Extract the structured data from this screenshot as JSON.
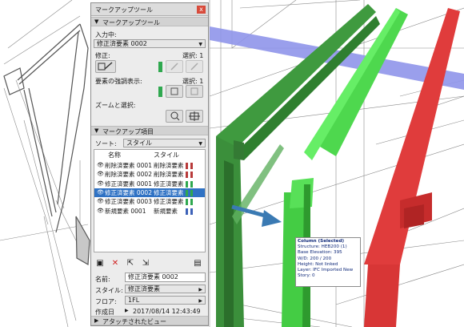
{
  "palette": {
    "title": "マークアップツール",
    "close_glyph": "x",
    "tools_section": "マークアップツール",
    "input_label": "入力中:",
    "input_value": "修正済要素 0002",
    "modify_label": "修正:",
    "modify_selected": "選択: 1",
    "highlight_label": "要素の強調表示:",
    "highlight_selected": "選択: 1",
    "zoom_label": "ズームと選択:",
    "items_section": "マークアップ項目",
    "sort_label": "ソート:",
    "sort_value": "スタイル",
    "col_name": "名称",
    "col_style": "スタイル",
    "items": [
      {
        "name": "削除済要素 0001",
        "style": "削除済要素",
        "color": "#b83a3a"
      },
      {
        "name": "削除済要素 0002",
        "style": "削除済要素",
        "color": "#b83a3a"
      },
      {
        "name": "修正済要素 0001",
        "style": "修正済要素",
        "color": "#2fa84f"
      },
      {
        "name": "修正済要素 0002",
        "style": "修正済要素",
        "color": "#2fa84f"
      },
      {
        "name": "修正済要素 0003",
        "style": "修正済要素",
        "color": "#2fa84f"
      },
      {
        "name": "新規要素 0001",
        "style": "新規要素",
        "color": "#3d62b8"
      }
    ],
    "name_label": "名前:",
    "name_value": "修正済要素 0002",
    "style_label": "スタイル:",
    "style_value": "修正済要素",
    "floor_label": "フロア:",
    "floor_value": "1FL",
    "created_label": "作成日",
    "created_value": "2017/08/14 12:43:49",
    "attached_section": "アタッチされたビュー"
  },
  "tooltip": {
    "title": "Column (Selected)",
    "structure": "Structure: HEB200 (1)",
    "base_elevation": "Base Elevation: 395",
    "wd": "W/D: 200 / 200",
    "height": "Height: Not linked",
    "layer": "Layer: IFC Imported New",
    "story": "Story: 0"
  }
}
